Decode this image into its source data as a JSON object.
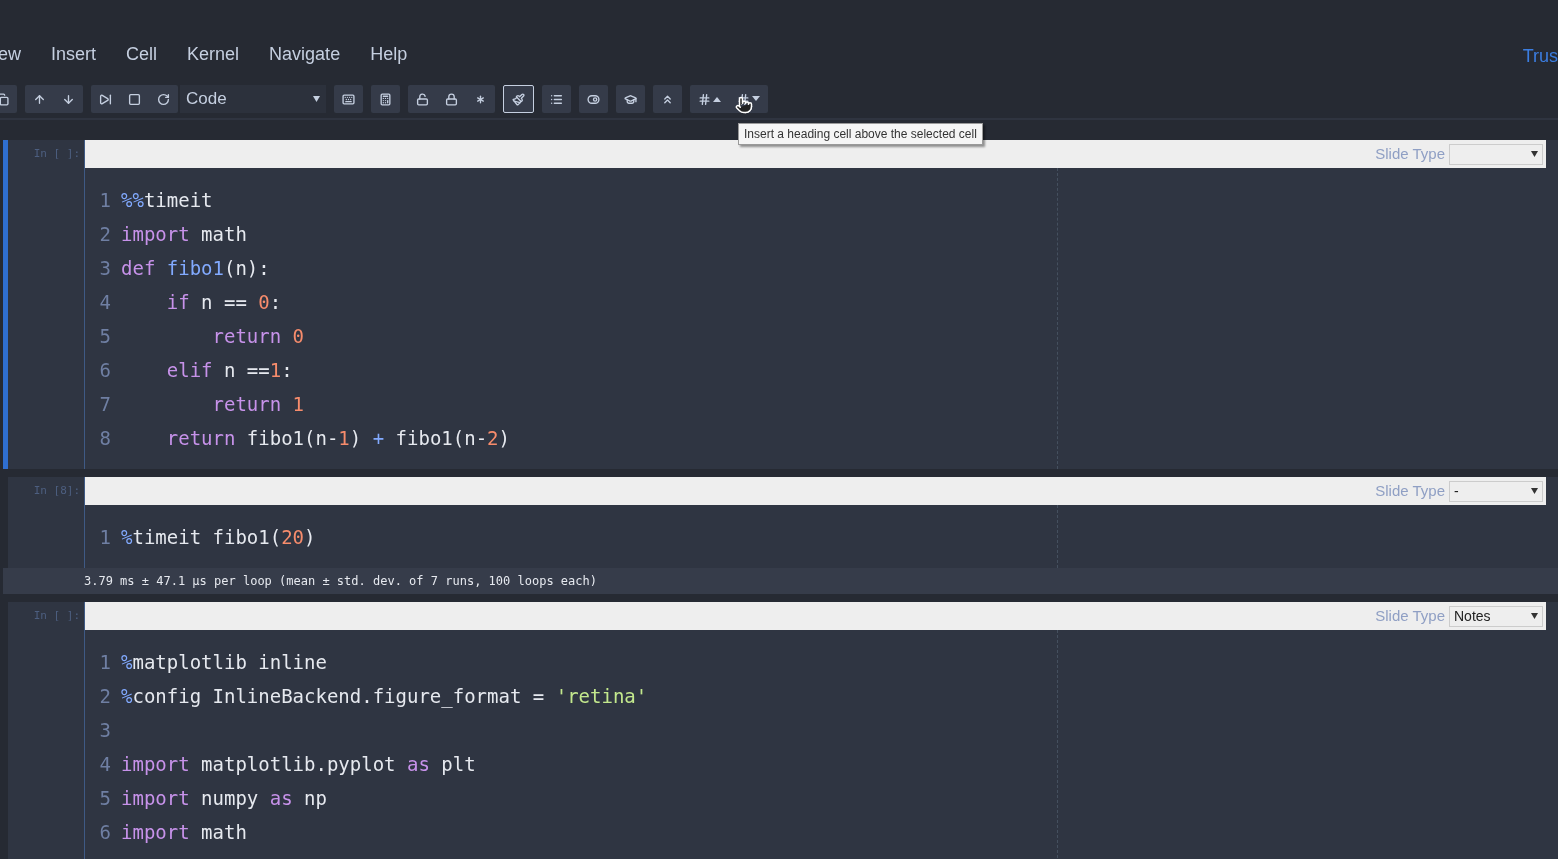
{
  "menu": [
    "ew",
    "Insert",
    "Cell",
    "Kernel",
    "Navigate",
    "Help"
  ],
  "trusted": "Trus",
  "toolbar": {
    "cell_type": "Code",
    "groups": [
      {
        "buttons": [
          {
            "selected": false
          }
        ]
      },
      {
        "buttons": [
          {
            "selected": false
          },
          {
            "selected": false
          }
        ]
      },
      {
        "buttons": [
          {
            "selected": false
          },
          {
            "selected": false
          },
          {
            "selected": false
          }
        ]
      },
      {
        "kind": "select"
      },
      {
        "buttons": [
          {
            "selected": false
          }
        ]
      },
      {
        "buttons": [
          {
            "selected": false
          }
        ]
      },
      {
        "buttons": [
          {
            "selected": false
          },
          {
            "selected": false
          },
          {
            "selected": false
          }
        ]
      },
      {
        "buttons": [
          {
            "selected": true
          }
        ]
      },
      {
        "buttons": [
          {
            "selected": false
          }
        ]
      },
      {
        "buttons": [
          {
            "selected": false
          }
        ]
      },
      {
        "buttons": [
          {
            "selected": false
          }
        ]
      },
      {
        "buttons": [
          {
            "selected": false
          }
        ]
      },
      {
        "buttons": [
          {
            "selected": false
          },
          {
            "selected": false
          }
        ]
      }
    ]
  },
  "tooltip": "Insert a heading cell above the selected cell",
  "cells": [
    {
      "prompt": "In [ ]:",
      "selected": true,
      "slide_label": "Slide Type",
      "lines": [
        {
          "number": "1",
          "tokens": [
            {
              "text": "%%",
              "kind": "magic"
            },
            {
              "text": "timeit",
              "kind": "plain"
            }
          ]
        },
        {
          "number": "2",
          "tokens": [
            {
              "text": "import",
              "kind": "keyword"
            },
            {
              "text": " math",
              "kind": "plain"
            }
          ]
        },
        {
          "number": "3",
          "tokens": [
            {
              "text": "def",
              "kind": "keyword"
            },
            {
              "text": " fibo1",
              "kind": "func"
            },
            {
              "text": "(n):",
              "kind": "plain"
            }
          ]
        },
        {
          "number": "4",
          "tokens": [
            {
              "text": "    if",
              "kind": "keyword"
            },
            {
              "text": " n == ",
              "kind": "plain"
            },
            {
              "text": "0",
              "kind": "number"
            },
            {
              "text": ":",
              "kind": "plain"
            }
          ]
        },
        {
          "number": "5",
          "tokens": [
            {
              "text": "        return",
              "kind": "keyword"
            },
            {
              "text": " 0",
              "kind": "number"
            }
          ]
        },
        {
          "number": "6",
          "tokens": [
            {
              "text": "    elif",
              "kind": "keyword"
            },
            {
              "text": " n ==",
              "kind": "plain"
            },
            {
              "text": "1",
              "kind": "number"
            },
            {
              "text": ":",
              "kind": "plain"
            }
          ]
        },
        {
          "number": "7",
          "tokens": [
            {
              "text": "        return",
              "kind": "keyword"
            },
            {
              "text": " 1",
              "kind": "number"
            }
          ]
        },
        {
          "number": "8",
          "tokens": [
            {
              "text": "    return",
              "kind": "keyword"
            },
            {
              "text": " fibo1(n-",
              "kind": "plain"
            },
            {
              "text": "1",
              "kind": "number"
            },
            {
              "text": ") ",
              "kind": "plain"
            },
            {
              "text": "+",
              "kind": "magic"
            },
            {
              "text": " fibo1(n-",
              "kind": "plain"
            },
            {
              "text": "2",
              "kind": "number"
            },
            {
              "text": ")",
              "kind": "plain"
            }
          ]
        }
      ]
    },
    {
      "prompt": "In [8]:",
      "selected": false,
      "slide_label": "Slide Type",
      "slide_type": "-",
      "lines": [
        {
          "number": "1",
          "tokens": [
            {
              "text": "%",
              "kind": "magic"
            },
            {
              "text": "timeit fibo1(",
              "kind": "plain"
            },
            {
              "text": "20",
              "kind": "number"
            },
            {
              "text": ")",
              "kind": "plain"
            }
          ]
        }
      ],
      "output": "3.79 ms ± 47.1 µs per loop (mean ± std. dev. of 7 runs, 100 loops each)"
    },
    {
      "prompt": "In [ ]:",
      "selected": false,
      "slide_label": "Slide Type",
      "slide_type": "Notes",
      "lines": [
        {
          "number": "1",
          "tokens": [
            {
              "text": "%",
              "kind": "magic"
            },
            {
              "text": "matplotlib inline",
              "kind": "plain"
            }
          ]
        },
        {
          "number": "2",
          "tokens": [
            {
              "text": "%",
              "kind": "magic"
            },
            {
              "text": "config InlineBackend.figure_format = ",
              "kind": "plain"
            },
            {
              "text": "'retina'",
              "kind": "string"
            }
          ]
        },
        {
          "number": "3"
        },
        {
          "number": "4",
          "tokens": [
            {
              "text": "import",
              "kind": "keyword"
            },
            {
              "text": " matplotlib.pyplot ",
              "kind": "plain"
            },
            {
              "text": "as",
              "kind": "keyword"
            },
            {
              "text": " plt",
              "kind": "plain"
            }
          ]
        },
        {
          "number": "5",
          "tokens": [
            {
              "text": "import",
              "kind": "keyword"
            },
            {
              "text": " numpy ",
              "kind": "plain"
            },
            {
              "text": "as",
              "kind": "keyword"
            },
            {
              "text": " np",
              "kind": "plain"
            }
          ]
        },
        {
          "number": "6",
          "tokens": [
            {
              "text": "import",
              "kind": "keyword"
            },
            {
              "text": " math",
              "kind": "plain"
            }
          ]
        }
      ]
    }
  ]
}
